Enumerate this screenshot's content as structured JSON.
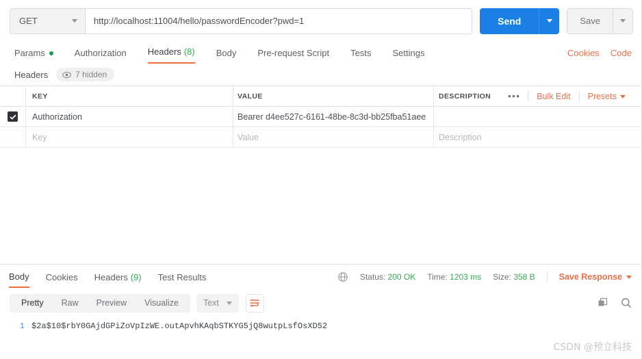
{
  "request": {
    "method": "GET",
    "url": "http://localhost:11004/hello/passwordEncoder?pwd=1",
    "send_label": "Send",
    "save_label": "Save",
    "tabs": [
      {
        "label": "Params",
        "count": "",
        "dot": true,
        "active": false
      },
      {
        "label": "Authorization",
        "count": "",
        "dot": false,
        "active": false
      },
      {
        "label": "Headers",
        "count": "(8)",
        "dot": false,
        "active": true
      },
      {
        "label": "Body",
        "count": "",
        "dot": false,
        "active": false
      },
      {
        "label": "Pre-request Script",
        "count": "",
        "dot": false,
        "active": false
      },
      {
        "label": "Tests",
        "count": "",
        "dot": false,
        "active": false
      },
      {
        "label": "Settings",
        "count": "",
        "dot": false,
        "active": false
      }
    ],
    "cookies_link": "Cookies",
    "code_link": "Code"
  },
  "headers_section": {
    "title": "Headers",
    "hidden_pill": "7 hidden",
    "columns": {
      "key": "KEY",
      "value": "VALUE",
      "description": "DESCRIPTION"
    },
    "actions": {
      "more": "•••",
      "bulk_edit": "Bulk Edit",
      "presets": "Presets"
    },
    "rows": [
      {
        "checked": true,
        "key": "Authorization",
        "value": "Bearer d4ee527c-6161-48be-8c3d-bb25fba51aee",
        "description": ""
      }
    ],
    "placeholders": {
      "key": "Key",
      "value": "Value",
      "description": "Description"
    }
  },
  "response": {
    "tabs": [
      {
        "label": "Body",
        "count": "",
        "active": true
      },
      {
        "label": "Cookies",
        "count": "",
        "active": false
      },
      {
        "label": "Headers",
        "count": "(9)",
        "active": false
      },
      {
        "label": "Test Results",
        "count": "",
        "active": false
      }
    ],
    "status_label": "Status:",
    "status_value": "200 OK",
    "time_label": "Time:",
    "time_value": "1203 ms",
    "size_label": "Size:",
    "size_value": "358 B",
    "save_response": "Save Response",
    "view_modes": [
      {
        "label": "Pretty",
        "active": true
      },
      {
        "label": "Raw",
        "active": false
      },
      {
        "label": "Preview",
        "active": false
      },
      {
        "label": "Visualize",
        "active": false
      }
    ],
    "content_type": "Text",
    "body_lines": [
      {
        "num": "1",
        "text": "$2a$10$rbY0GAjdGPiZoVpIzWE.outApvhKAqbSTKYG5jQ8wutpLsfOsXD52"
      }
    ]
  },
  "watermark": "CSDN @预立科技",
  "colors": {
    "accent_orange": "#e8704a",
    "send_blue": "#1a80e4",
    "success_green": "#3aa757",
    "tab_underline": "#ef6c3e"
  }
}
